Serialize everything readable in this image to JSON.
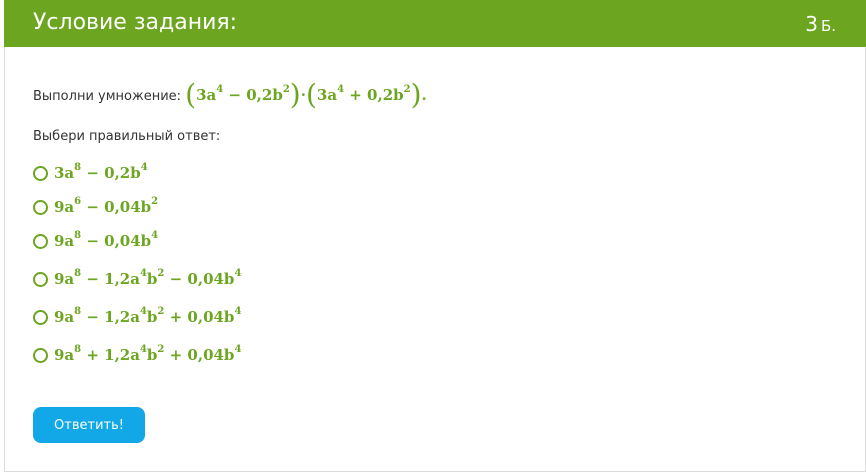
{
  "header": {
    "title": "Условие задания:",
    "score_value": "3",
    "score_unit": "Б."
  },
  "task": {
    "instruction": "Выполни умножение:",
    "paren_open": "(",
    "paren_close": ")",
    "factor1_pre": "3a",
    "factor1_exp1": "4",
    "factor1_mid": " − 0,2b",
    "factor1_exp2": "2",
    "dot": "·",
    "factor2_pre": "3a",
    "factor2_exp1": "4",
    "factor2_mid": " + 0,2b",
    "factor2_exp2": "2",
    "end": "."
  },
  "prompt": "Выбери правильный ответ:",
  "options": [
    {
      "p1": "3a",
      "e1": "8",
      "p2": " − 0,2b",
      "e2": "4"
    },
    {
      "p1": "9a",
      "e1": "6",
      "p2": " − 0,04b",
      "e2": "2"
    },
    {
      "p1": "9a",
      "e1": "8",
      "p2": " − 0,04b",
      "e2": "4"
    },
    {
      "p1": "9a",
      "e1": "8",
      "p2": " − 1,2a",
      "e2": "4",
      "p3": "b",
      "e3": "2",
      "p4": " − 0,04b",
      "e4": "4"
    },
    {
      "p1": "9a",
      "e1": "8",
      "p2": " − 1,2a",
      "e2": "4",
      "p3": "b",
      "e3": "2",
      "p4": " + 0,04b",
      "e4": "4"
    },
    {
      "p1": "9a",
      "e1": "8",
      "p2": " + 1,2a",
      "e2": "4",
      "p3": "b",
      "e3": "2",
      "p4": " + 0,04b",
      "e4": "4"
    }
  ],
  "submit_label": "Ответить!",
  "colors": {
    "header_bg": "#6ca51f",
    "math": "#6ca51f",
    "button_bg": "#12a7e6"
  }
}
